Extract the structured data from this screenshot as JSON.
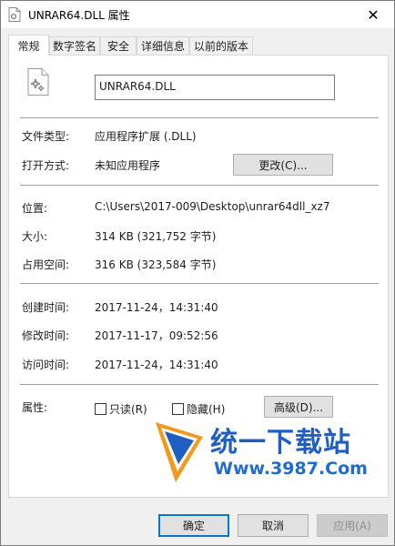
{
  "window": {
    "title": "UNRAR64.DLL 属性",
    "close_glyph": "✕"
  },
  "tabs": [
    {
      "label": "常规",
      "active": true
    },
    {
      "label": "数字签名",
      "active": false
    },
    {
      "label": "安全",
      "active": false
    },
    {
      "label": "详细信息",
      "active": false
    },
    {
      "label": "以前的版本",
      "active": false
    }
  ],
  "general": {
    "file_name": "UNRAR64.DLL",
    "file_type_label": "文件类型:",
    "file_type_value": "应用程序扩展 (.DLL)",
    "open_with_label": "打开方式:",
    "open_with_value": "未知应用程序",
    "change_button": "更改(C)...",
    "location_label": "位置:",
    "location_value": "C:\\Users\\2017-009\\Desktop\\unrar64dll_xz7",
    "size_label": "大小:",
    "size_value": "314 KB (321,752 字节)",
    "size_on_disk_label": "占用空间:",
    "size_on_disk_value": "316 KB (323,584 字节)",
    "created_label": "创建时间:",
    "created_value": "2017-11-24，14:31:40",
    "modified_label": "修改时间:",
    "modified_value": "2017-11-17，09:52:56",
    "accessed_label": "访问时间:",
    "accessed_value": "2017-11-24，14:31:40",
    "attributes_label": "属性:",
    "readonly_label": "只读(R)",
    "hidden_label": "隐藏(H)",
    "advanced_button": "高级(D)..."
  },
  "watermark": {
    "text": "统一下载站",
    "url": "Www.3987.Com"
  },
  "footer": {
    "ok": "确定",
    "cancel": "取消",
    "apply": "应用(A)"
  },
  "colors": {
    "accent": "#0078d7",
    "watermark_blue": "#1f5fc3",
    "watermark_orange": "#f39a1e"
  },
  "icons": {
    "title": "dll-file-icon",
    "file": "dll-file-gear-icon",
    "close": "close-icon",
    "watermark": "watermark-logo-icon"
  }
}
